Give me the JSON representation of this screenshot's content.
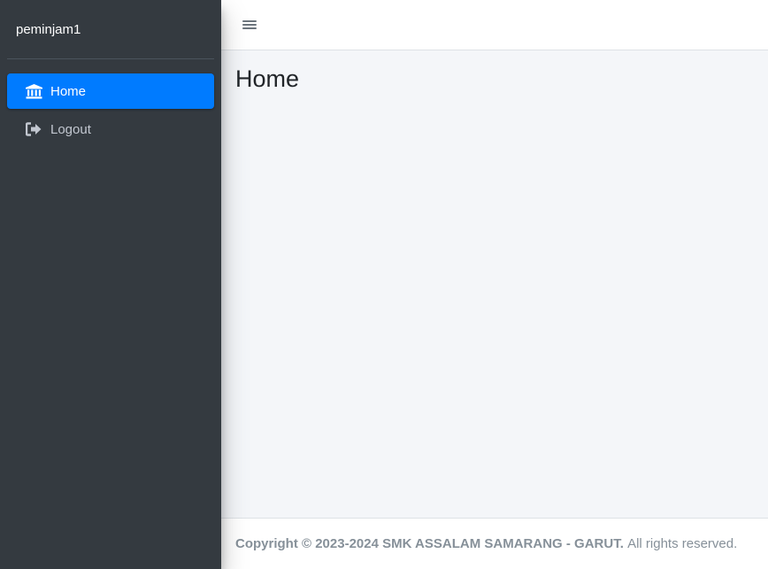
{
  "sidebar": {
    "brand": "peminjam1",
    "items": [
      {
        "label": "Home",
        "icon": "bank-icon",
        "active": true
      },
      {
        "label": "Logout",
        "icon": "sign-out-icon",
        "active": false
      }
    ]
  },
  "navbar": {
    "menu_icon": "hamburger-icon"
  },
  "main": {
    "title": "Home"
  },
  "footer": {
    "copyright": "Copyright © 2023-2024 SMK ASSALAM SAMARANG - GARUT.",
    "rights": "All rights reserved."
  },
  "colors": {
    "sidebar_bg": "#343a40",
    "active_item": "#007bff",
    "content_bg": "#f4f6f9"
  }
}
